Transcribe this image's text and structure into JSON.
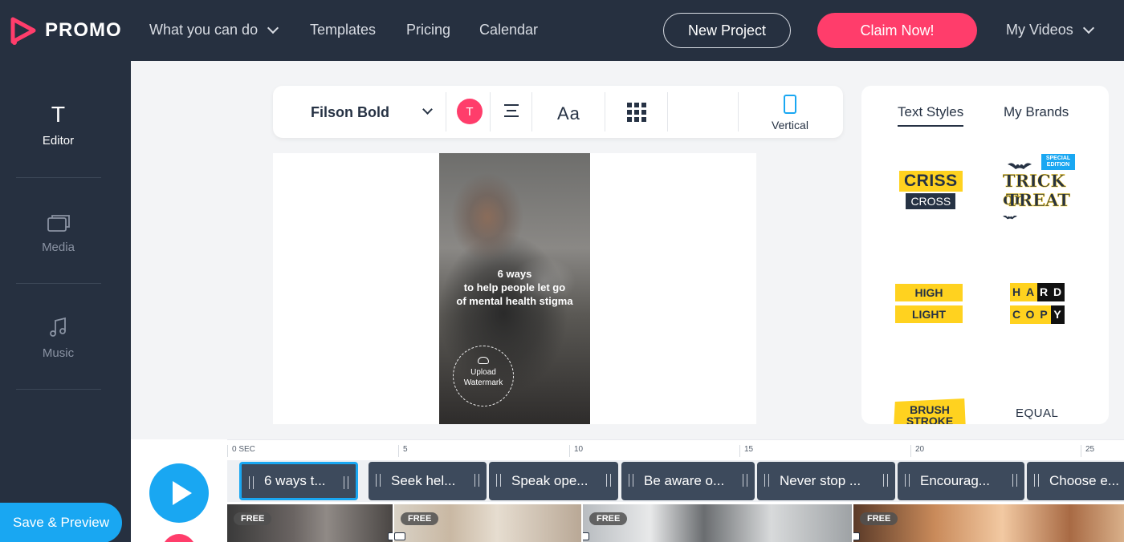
{
  "brand": {
    "name": "PROMO",
    "accent": "#ff3d6b",
    "blue": "#19a7f2",
    "navy": "#263040"
  },
  "nav": {
    "items": [
      "What you can do",
      "Templates",
      "Pricing",
      "Calendar"
    ],
    "new_project": "New Project",
    "claim": "Claim Now!",
    "my_videos": "My Videos"
  },
  "sidebar": {
    "editor_icon": "T",
    "items": [
      {
        "label": "Editor",
        "icon": "text-icon"
      },
      {
        "label": "Media",
        "icon": "media-icon"
      },
      {
        "label": "Music",
        "icon": "music-icon"
      }
    ]
  },
  "toolbar": {
    "font": "Filson Bold",
    "color_letter": "T",
    "size_label": "Aa",
    "orientation": "Vertical"
  },
  "canvas": {
    "headline_1": "6 ways",
    "headline_2": "to help people let go",
    "headline_3": "of mental health stigma",
    "watermark_1": "Upload",
    "watermark_2": "Watermark"
  },
  "right_panel": {
    "tabs": [
      "Text Styles",
      "My Brands"
    ],
    "styles": {
      "criss_1": "CRISS",
      "criss_2": "CROSS",
      "badge": "SPECIAL EDITION",
      "trick_1": "TRICK or",
      "trick_2": "TREAT",
      "high": "HIGH",
      "light": "LIGHT",
      "hard": [
        "H",
        "A",
        "R",
        "D"
      ],
      "copy": [
        "C",
        "O",
        "P",
        "Y"
      ],
      "brush": "BRUSH STROKE",
      "equal": "EQUAL"
    }
  },
  "timeline": {
    "ticks": [
      "0 SEC",
      "5",
      "10",
      "15",
      "20",
      "25"
    ],
    "clips": [
      "6 ways t...",
      "Seek hel...",
      "Speak ope...",
      "Be aware o...",
      "Never stop ...",
      "Encourag...",
      "Choose e..."
    ],
    "free_label": "FREE",
    "save_preview": "Save & Preview"
  }
}
